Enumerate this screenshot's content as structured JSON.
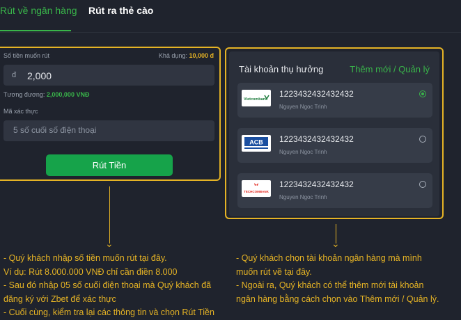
{
  "tabs": [
    {
      "label": "Rút về ngân hàng"
    },
    {
      "label": "Rút ra thẻ cào"
    }
  ],
  "form": {
    "amount_label": "Số tiền muốn rút",
    "available_label": "Khả dụng:",
    "available_value": "10,000 đ",
    "currency_symbol": "đ",
    "amount_value": "2,000",
    "equivalent_label": "Tương đương:",
    "equivalent_value": "2,000,000 VNĐ",
    "otp_label": "Mã xác thực",
    "otp_placeholder": "5 số cuối số điện thoại",
    "submit_label": "Rút Tiền"
  },
  "accounts": {
    "title": "Tài khoản thụ hưởng",
    "manage_label": "Thêm mới / Quản lý",
    "items": [
      {
        "bank": "Vietcombank",
        "logo_text": "Vietcombank",
        "account_number": "1223432432432432",
        "holder": "Nguyen Ngoc Trinh",
        "selected": true
      },
      {
        "bank": "ACB",
        "logo_text": "ACB",
        "account_number": "1223432432432432",
        "holder": "Nguyen Ngoc Trinh",
        "selected": false
      },
      {
        "bank": "Techcombank",
        "logo_text": "TECHCOMBANK",
        "account_number": "1223432432432432",
        "holder": "Nguyen Ngoc Trinh",
        "selected": false
      }
    ]
  },
  "notes": {
    "left": [
      "- Quý khách nhập số tiền muốn rút tại đây.",
      "Ví dụ: Rút 8.000.000 VNĐ  chỉ cần điền 8.000",
      "- Sau đó nhập 05 số cuối điện thoại mà Quý khách đã",
      "đăng ký với Zbet để xác thực",
      "- Cuối cùng, kiểm tra lại các thông tin và chọn Rút Tiền"
    ],
    "right": [
      "- Quý khách chọn tài khoản ngân hàng mà mình",
      "muốn rút về tại đây.",
      "- Ngoài ra, Quý khách có thể thêm mới tài khoản",
      "ngân hàng bằng cách chọn vào Thêm mới / Quản lý."
    ]
  },
  "colors": {
    "accent_green": "#39b54a",
    "highlight_yellow": "#e5b325",
    "background": "#1f232d"
  }
}
